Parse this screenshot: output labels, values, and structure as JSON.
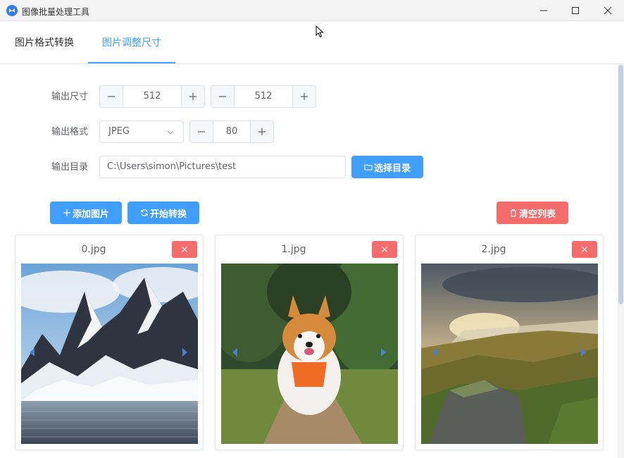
{
  "window": {
    "title": "图像批量处理工具"
  },
  "tabs": [
    {
      "label": "图片格式转换",
      "active": false
    },
    {
      "label": "图片调整尺寸",
      "active": true
    }
  ],
  "form": {
    "size_label": "输出尺寸",
    "width_value": "512",
    "height_value": "512",
    "format_label": "输出格式",
    "format_value": "JPEG",
    "quality_value": "80",
    "dir_label": "输出目录",
    "dir_value": "C:\\Users\\simon\\Pictures\\test",
    "choose_dir_label": "选择目录"
  },
  "actions": {
    "add_label": "添加图片",
    "start_label": "开始转换",
    "clear_label": "清空列表"
  },
  "images": [
    {
      "name": "0.jpg"
    },
    {
      "name": "1.jpg"
    },
    {
      "name": "2.jpg"
    }
  ],
  "colors": {
    "primary": "#409eff",
    "danger": "#f56c6c"
  }
}
